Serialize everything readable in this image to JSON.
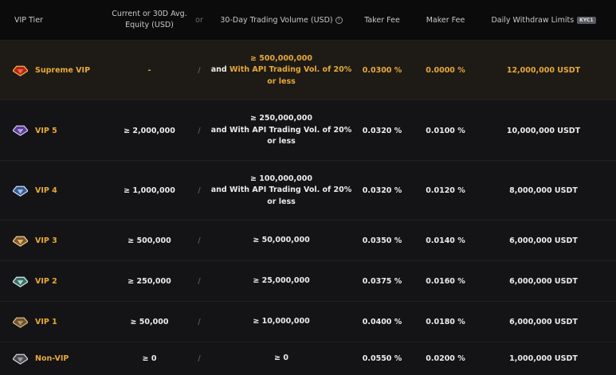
{
  "header": {
    "tier": "VIP Tier",
    "equity": "Current or 30D Avg. Equity (USD)",
    "or": "or",
    "volume": "30-Day Trading Volume (USD)",
    "info_icon": "?",
    "taker": "Taker Fee",
    "maker": "Maker Fee",
    "limits": "Daily Withdraw Limits",
    "kyc_badge": "KYC1"
  },
  "colors": {
    "gold_accent": "#e8a93a",
    "row_bg": "#141416",
    "supreme_row_bg": "#1e1b16"
  },
  "rows": [
    {
      "tier": "Supreme VIP",
      "icon": "supreme-gem-icon",
      "equity": "-",
      "sep": "/",
      "vol_line1": "≥ 500,000,000",
      "vol_and": "and ",
      "vol_api": "With API Trading Vol. of 20% or less",
      "taker": "0.0300 %",
      "maker": "0.0000 %",
      "limit": "12,000,000 USDT"
    },
    {
      "tier": "VIP 5",
      "icon": "vip5-gem-icon",
      "equity": "≥ 2,000,000",
      "sep": "/",
      "vol_line1": "≥ 250,000,000",
      "vol_rest": "and With API Trading Vol. of 20% or less",
      "taker": "0.0320 %",
      "maker": "0.0100 %",
      "limit": "10,000,000 USDT"
    },
    {
      "tier": "VIP 4",
      "icon": "vip4-gem-icon",
      "equity": "≥ 1,000,000",
      "sep": "/",
      "vol_line1": "≥ 100,000,000",
      "vol_rest": "and With API Trading Vol. of 20% or less",
      "taker": "0.0320 %",
      "maker": "0.0120 %",
      "limit": "8,000,000 USDT"
    },
    {
      "tier": "VIP 3",
      "icon": "vip3-gem-icon",
      "equity": "≥ 500,000",
      "sep": "/",
      "volume": "≥ 50,000,000",
      "taker": "0.0350 %",
      "maker": "0.0140 %",
      "limit": "6,000,000 USDT"
    },
    {
      "tier": "VIP 2",
      "icon": "vip2-gem-icon",
      "equity": "≥ 250,000",
      "sep": "/",
      "volume": "≥ 25,000,000",
      "taker": "0.0375 %",
      "maker": "0.0160 %",
      "limit": "6,000,000 USDT"
    },
    {
      "tier": "VIP 1",
      "icon": "vip1-gem-icon",
      "equity": "≥ 50,000",
      "sep": "/",
      "volume": "≥ 10,000,000",
      "taker": "0.0400 %",
      "maker": "0.0180 %",
      "limit": "6,000,000 USDT"
    },
    {
      "tier": "Non-VIP",
      "icon": "non-vip-gem-icon",
      "equity": "≥ 0",
      "sep": "/",
      "volume": "≥ 0",
      "taker": "0.0550 %",
      "maker": "0.0200 %",
      "limit": "1,000,000 USDT"
    }
  ]
}
